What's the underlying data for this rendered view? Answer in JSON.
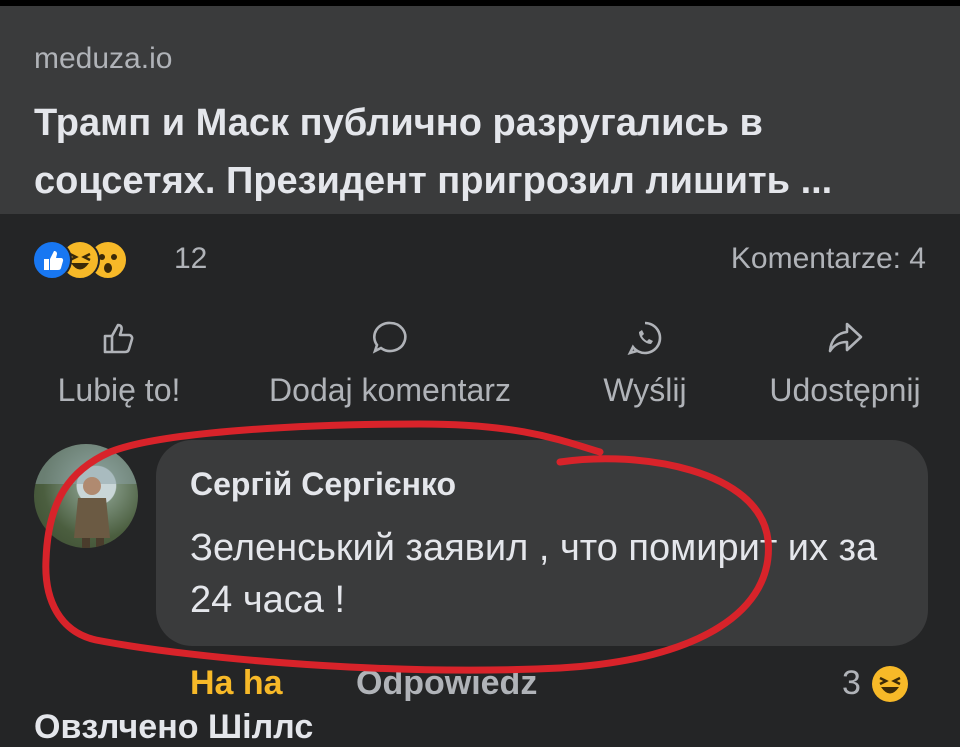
{
  "link_preview": {
    "domain": "meduza.io",
    "title": "Трамп и Маск публично разругались в соцсетях. Президент пригрозил лишить ..."
  },
  "stats": {
    "reaction_icons": [
      "like-icon",
      "haha-icon",
      "wow-icon"
    ],
    "reaction_count": "12",
    "comment_count": "Komentarze: 4"
  },
  "actions": {
    "like": "Lubię to!",
    "comment": "Dodaj komentarz",
    "send": "Wyślij",
    "share": "Udostępnij"
  },
  "comment": {
    "author": "Сергій Сергієнко",
    "text": "Зеленський заявил , что помирит их за 24 часа !",
    "reaction_label": "Ha ha",
    "reply_label": "Odpowiedz",
    "reaction_count": "3"
  },
  "next_comment_author": "Овзлчено Шіллс",
  "colors": {
    "background": "#242526",
    "preview_bg": "#3a3b3c",
    "accent_like": "#1877f2",
    "haha_yellow": "#f7b928",
    "annotation_red": "#d8232a"
  }
}
